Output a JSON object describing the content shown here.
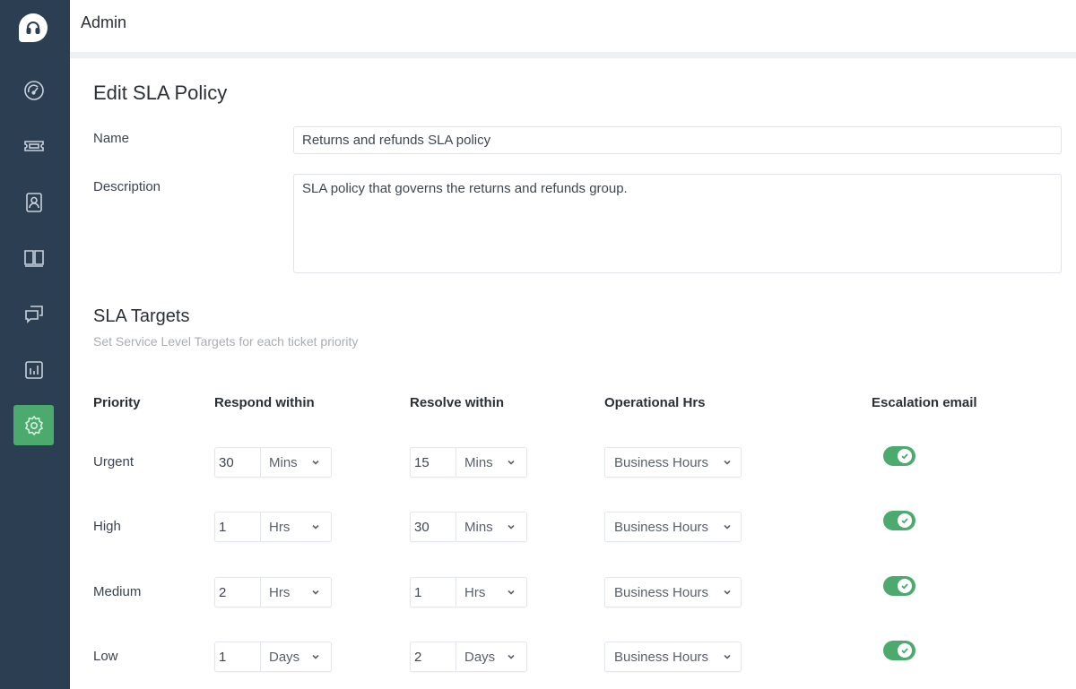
{
  "app": {
    "section_title": "Admin"
  },
  "sidebar": {
    "items": [
      {
        "name": "dashboard",
        "icon": "gauge-icon"
      },
      {
        "name": "tickets",
        "icon": "ticket-icon"
      },
      {
        "name": "contacts",
        "icon": "contact-icon"
      },
      {
        "name": "knowledge-base",
        "icon": "book-icon"
      },
      {
        "name": "forums",
        "icon": "chat-bubbles-icon"
      },
      {
        "name": "reports",
        "icon": "bar-chart-icon"
      },
      {
        "name": "admin",
        "icon": "gear-icon",
        "active": true
      }
    ],
    "active_color": "#4caa6e"
  },
  "form": {
    "title": "Edit SLA Policy",
    "name_label": "Name",
    "name_value": "Returns and refunds SLA policy",
    "description_label": "Description",
    "description_value": "SLA policy that governs the returns and refunds group."
  },
  "targets": {
    "title": "SLA Targets",
    "subtitle": "Set Service Level Targets for each ticket priority",
    "columns": [
      "Priority",
      "Respond within",
      "Resolve within",
      "Operational Hrs",
      "Escalation email"
    ],
    "rows": [
      {
        "priority": "Urgent",
        "respond_value": "30",
        "respond_unit": "Mins",
        "resolve_value": "15",
        "resolve_unit": "Mins",
        "operational_hrs": "Business Hours",
        "escalation_email": true
      },
      {
        "priority": "High",
        "respond_value": "1",
        "respond_unit": "Hrs",
        "resolve_value": "30",
        "resolve_unit": "Mins",
        "operational_hrs": "Business Hours",
        "escalation_email": true
      },
      {
        "priority": "Medium",
        "respond_value": "2",
        "respond_unit": "Hrs",
        "resolve_value": "1",
        "resolve_unit": "Hrs",
        "operational_hrs": "Business Hours",
        "escalation_email": true
      },
      {
        "priority": "Low",
        "respond_value": "1",
        "respond_unit": "Days",
        "resolve_value": "2",
        "resolve_unit": "Days",
        "operational_hrs": "Business Hours",
        "escalation_email": true
      }
    ]
  }
}
